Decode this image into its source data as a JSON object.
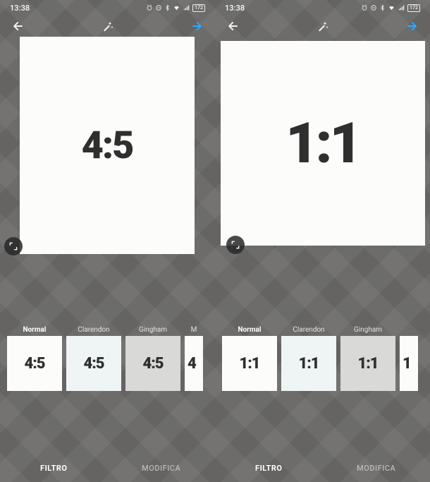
{
  "status": {
    "time": "13:38",
    "battery": "172"
  },
  "left": {
    "ratio_label": "4:5",
    "filters": {
      "normal": "Normal",
      "clarendon": "Clarendon",
      "gingham": "Gingham",
      "moon": "M",
      "thumb_text": "4:5",
      "moon_thumb_text": "4"
    }
  },
  "right": {
    "ratio_label": "1:1",
    "filters": {
      "normal": "Normal",
      "clarendon": "Clarendon",
      "gingham": "Gingham",
      "moon": "",
      "thumb_text": "1:1",
      "moon_thumb_text": "1"
    }
  },
  "tabs": {
    "filter": "FILTRO",
    "edit": "MODIFICA"
  }
}
